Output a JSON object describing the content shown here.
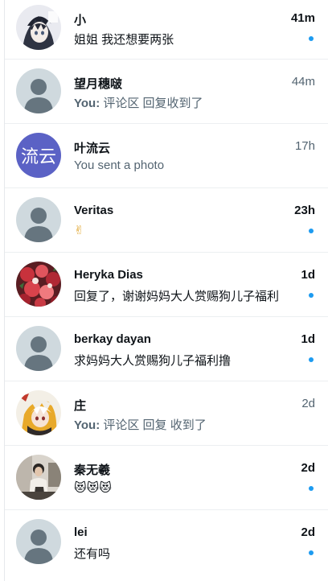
{
  "conversations": [
    {
      "name": "小",
      "preview": "姐姐 我还想要两张",
      "time": "41m",
      "unread": true
    },
    {
      "name": "望月穗啵",
      "you_prefix": "You:",
      "preview": "评论区 回复收到了",
      "time": "44m",
      "unread": false
    },
    {
      "name": "叶流云",
      "avatar_text": "流云",
      "preview": "You sent a photo",
      "time": "17h",
      "unread": false
    },
    {
      "name": "Veritas",
      "preview": "✌",
      "time": "23h",
      "unread": true
    },
    {
      "name": "Heryka Dias",
      "preview": "回复了，谢谢妈妈大人赏赐狗儿子福利",
      "time": "1d",
      "unread": true
    },
    {
      "name": "berkay dayan",
      "preview": "求妈妈大人赏赐狗儿子福利撸",
      "time": "1d",
      "unread": true
    },
    {
      "name": "庄",
      "you_prefix": "You:",
      "preview": "评论区 回复 收到了",
      "time": "2d",
      "unread": false
    },
    {
      "name": "秦无羲",
      "preview": "😻😻😻",
      "time": "2d",
      "unread": true
    },
    {
      "name": "lei",
      "preview": "还有吗",
      "time": "2d",
      "unread": true
    }
  ],
  "colors": {
    "accent_dot": "#1d9bf0",
    "text_primary": "#0f1419",
    "text_secondary": "#536471",
    "default_avatar_bg": "#cfd9de",
    "default_avatar_fg": "#66757f",
    "text_avatar_bg": "#5b62c5"
  },
  "icons": {
    "default_avatar": "default-profile-icon"
  }
}
